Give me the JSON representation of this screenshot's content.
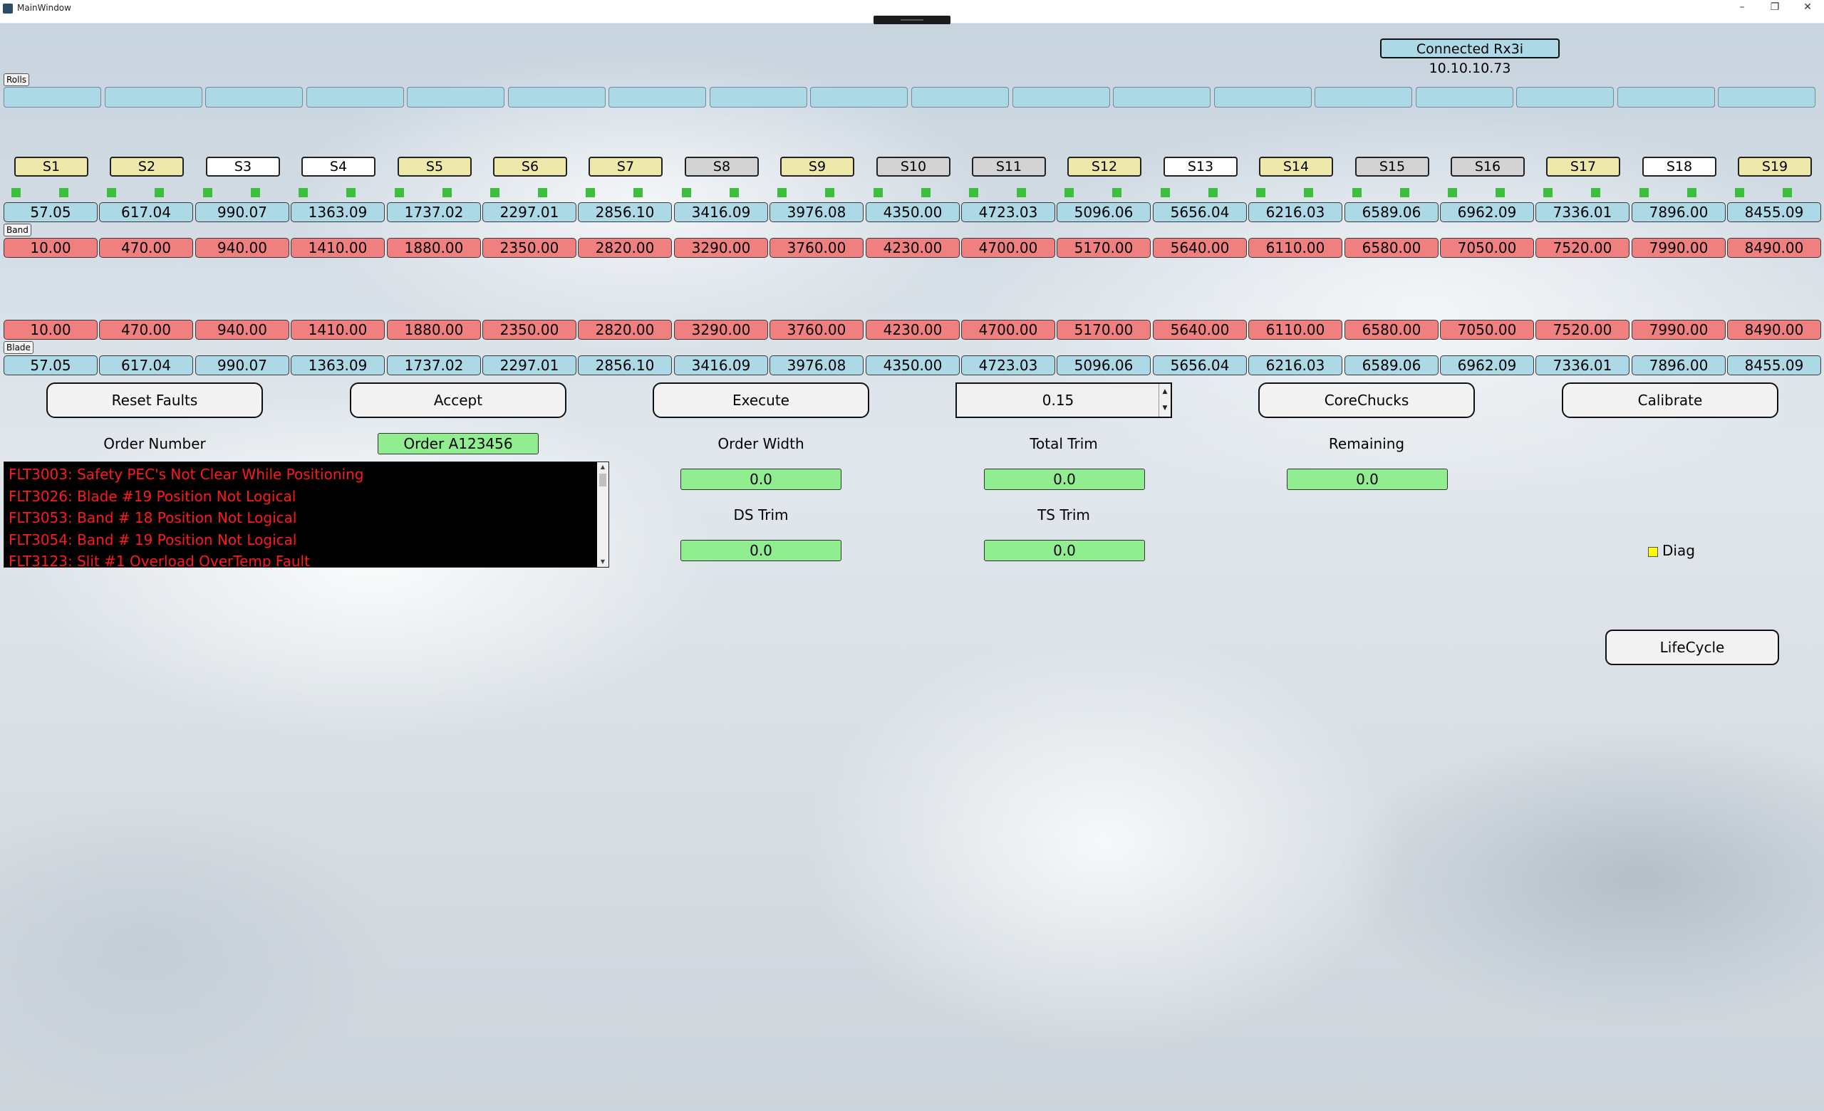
{
  "window": {
    "title": "MainWindow"
  },
  "connection": {
    "status": "Connected Rx3i 10.10.10.73"
  },
  "labels": {
    "rolls": "Rolls",
    "band": "Band",
    "blade": "Blade"
  },
  "slits": [
    "S1",
    "S2",
    "S3",
    "S4",
    "S5",
    "S6",
    "S7",
    "S8",
    "S9",
    "S10",
    "S11",
    "S12",
    "S13",
    "S14",
    "S15",
    "S16",
    "S17",
    "S18",
    "S19"
  ],
  "slit_colors": [
    "yellow",
    "yellow",
    "white",
    "white",
    "yellow",
    "yellow",
    "yellow",
    "grey",
    "yellow",
    "grey",
    "grey",
    "yellow",
    "white",
    "yellow",
    "grey",
    "grey",
    "yellow",
    "white",
    "yellow"
  ],
  "band_actual": [
    "57.05",
    "617.04",
    "990.07",
    "1363.09",
    "1737.02",
    "2297.01",
    "2856.10",
    "3416.09",
    "3976.08",
    "4350.00",
    "4723.03",
    "5096.06",
    "5656.04",
    "6216.03",
    "6589.06",
    "6962.09",
    "7336.01",
    "7896.00",
    "8455.09"
  ],
  "band_target": [
    "10.00",
    "470.00",
    "940.00",
    "1410.00",
    "1880.00",
    "2350.00",
    "2820.00",
    "3290.00",
    "3760.00",
    "4230.00",
    "4700.00",
    "5170.00",
    "5640.00",
    "6110.00",
    "6580.00",
    "7050.00",
    "7520.00",
    "7990.00",
    "8490.00"
  ],
  "blade_target": [
    "10.00",
    "470.00",
    "940.00",
    "1410.00",
    "1880.00",
    "2350.00",
    "2820.00",
    "3290.00",
    "3760.00",
    "4230.00",
    "4700.00",
    "5170.00",
    "5640.00",
    "6110.00",
    "6580.00",
    "7050.00",
    "7520.00",
    "7990.00",
    "8490.00"
  ],
  "blade_actual": [
    "57.05",
    "617.04",
    "990.07",
    "1363.09",
    "1737.02",
    "2297.01",
    "2856.10",
    "3416.09",
    "3976.08",
    "4350.00",
    "4723.03",
    "5096.06",
    "5656.04",
    "6216.03",
    "6589.06",
    "6962.09",
    "7336.01",
    "7896.00",
    "8455.09"
  ],
  "buttons": {
    "reset_faults": "Reset Faults",
    "accept": "Accept",
    "execute": "Execute",
    "core_chucks": "CoreChucks",
    "calibrate": "Calibrate",
    "lifecycle": "LifeCycle"
  },
  "spinner": {
    "value": "0.15"
  },
  "order": {
    "number_label": "Order Number",
    "number": "Order A123456",
    "width_label": "Order Width",
    "width": "0.0",
    "total_trim_label": "Total Trim",
    "total_trim": "0.0",
    "remaining_label": "Remaining",
    "remaining": "0.0",
    "ds_trim_label": "DS Trim",
    "ds_trim": "0.0",
    "ts_trim_label": "TS Trim",
    "ts_trim": "0.0"
  },
  "faults": [
    "FLT3003: Safety PEC's Not Clear While Positioning",
    "FLT3026: Blade #19 Position Not Logical",
    "FLT3053: Band # 18 Position Not Logical",
    "FLT3054: Band # 19 Position Not Logical",
    "FLT3123: Slit #1 Overload OverTemp Fault"
  ],
  "diag": {
    "label": "Diag"
  },
  "colors": {
    "blue": "#add8e6",
    "red": "#f08080",
    "green": "#90ee90",
    "led": "#3cbf3c",
    "fault_text": "#ff1a1a"
  }
}
